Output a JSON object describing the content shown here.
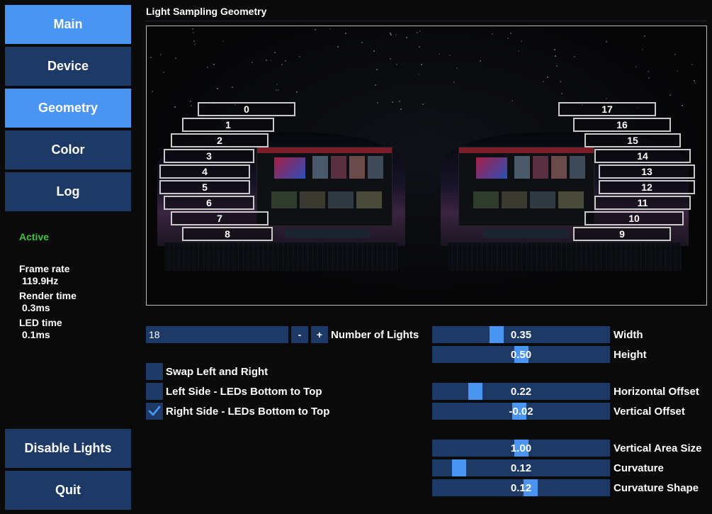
{
  "sidebar": {
    "nav": [
      {
        "label": "Main",
        "active": true
      },
      {
        "label": "Device",
        "active": false
      },
      {
        "label": "Geometry",
        "active": true
      },
      {
        "label": "Color",
        "active": false
      },
      {
        "label": "Log",
        "active": false
      }
    ],
    "status": "Active",
    "stats": {
      "frame_rate_label": "Frame rate",
      "frame_rate_value": "119.9Hz",
      "render_time_label": "Render time",
      "render_time_value": "0.3ms",
      "led_time_label": "LED time",
      "led_time_value": "0.1ms"
    },
    "disable_lights_label": "Disable Lights",
    "quit_label": "Quit"
  },
  "header": {
    "title": "Light Sampling Geometry"
  },
  "preview": {
    "left_leds": [
      "0",
      "1",
      "2",
      "3",
      "4",
      "5",
      "6",
      "7",
      "8"
    ],
    "right_leds": [
      "17",
      "16",
      "15",
      "14",
      "13",
      "12",
      "11",
      "10",
      "9"
    ]
  },
  "controls": {
    "number_of_lights": {
      "value": "18",
      "label": "Number of Lights",
      "minus": "-",
      "plus": "+"
    },
    "checkboxes": [
      {
        "label": "Swap Left and Right",
        "checked": false
      },
      {
        "label": "Left Side - LEDs Bottom to Top",
        "checked": false
      },
      {
        "label": "Right Side - LEDs Bottom to Top",
        "checked": true
      }
    ],
    "sliders": [
      {
        "label": "Width",
        "value": "0.35",
        "fraction": 0.35
      },
      {
        "label": "Height",
        "value": "0.50",
        "fraction": 0.5
      },
      {
        "label": "Horizontal Offset",
        "value": "0.22",
        "fraction": 0.22
      },
      {
        "label": "Vertical Offset",
        "value": "-0.02",
        "fraction": 0.49
      },
      {
        "label": "Vertical Area Size",
        "value": "1.00",
        "fraction": 0.5
      },
      {
        "label": "Curvature",
        "value": "0.12",
        "fraction": 0.12
      },
      {
        "label": "Curvature Shape",
        "value": "0.12",
        "fraction": 0.56
      }
    ]
  },
  "colors": {
    "accent": "#4a95f2",
    "control_bg": "#1d3a66",
    "status_active": "#3ec43e"
  }
}
